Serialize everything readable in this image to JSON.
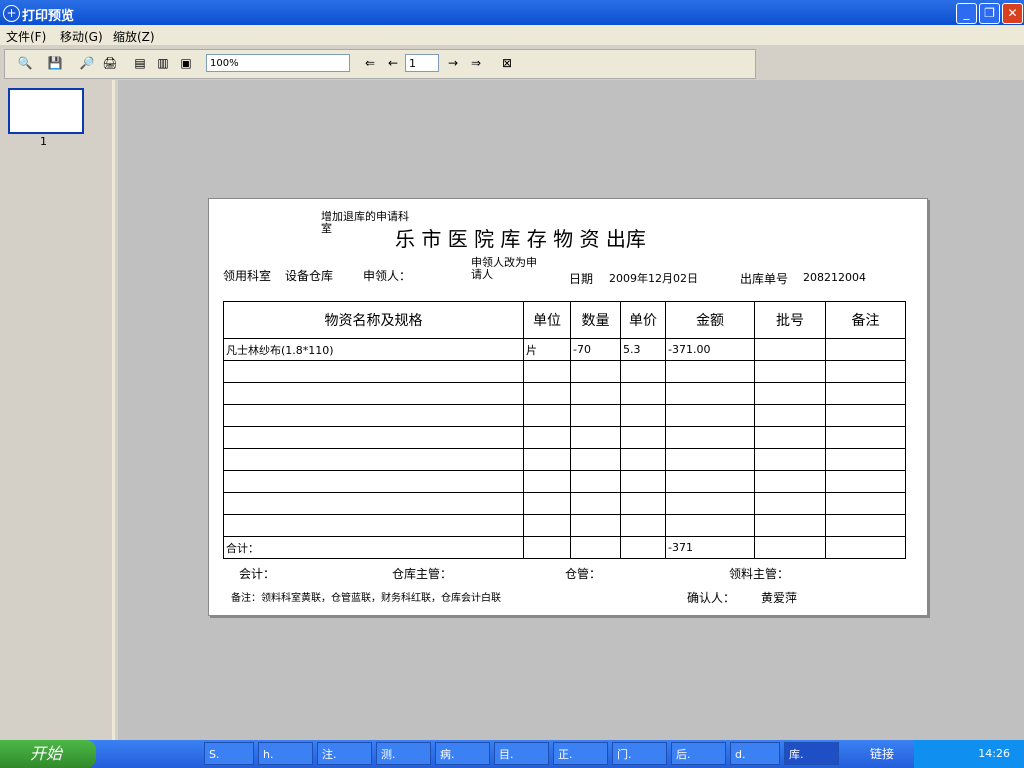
{
  "window": {
    "title": "打印预览"
  },
  "menu": [
    "文件(F)",
    "移动(G)",
    "缩放(Z)"
  ],
  "toolbar": {
    "zoom": "100%",
    "page_number": "1"
  },
  "thumbnail": {
    "page_label": "1"
  },
  "document": {
    "annotation_1": "增加退库的申请科室",
    "title": "乐 市 医 院 库 存 物 资 出库",
    "dept_label": "领用科室",
    "dept_value": "设备仓库",
    "applicant_label": "申领人：",
    "annotation_2": "申领人改为申请人",
    "date_label": "日期",
    "date_value": "2009年12月02日",
    "order_label": "出库单号",
    "order_value": "208212004",
    "headers": [
      "物资名称及规格",
      "单位",
      "数量",
      "单价",
      "金额",
      "批号",
      "备注"
    ],
    "rows": [
      [
        "凡士林纱布(1.8*110)",
        "片",
        "-70",
        "5.3",
        "-371.00",
        "",
        ""
      ]
    ],
    "total_label": "合计：",
    "total_amount": "-371",
    "footer": {
      "accounting": "会计：",
      "warehouse_supervisor": "仓库主管：",
      "warehouse": "仓管：",
      "receiving_supervisor": "领料主管：",
      "note": "备注：领料科室黄联，仓管蓝联，财务科红联，仓库会计白联",
      "confirm_label": "确认人：",
      "confirm_value": "黄爱萍"
    }
  },
  "taskbar": {
    "start": "开始",
    "tasks": [
      "S.",
      "h.",
      "注.",
      "测.",
      "病.",
      "目.",
      "正.",
      "门.",
      "后.",
      "d.",
      "库."
    ],
    "links": "链接",
    "clock": "14:26"
  }
}
